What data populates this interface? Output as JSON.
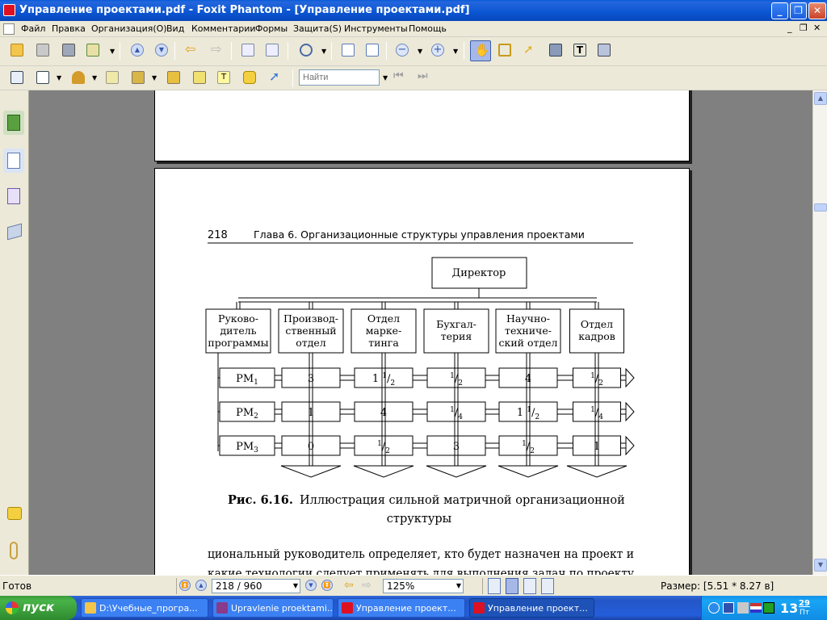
{
  "window": {
    "title": "Управление проектами.pdf - Foxit Phantom - [Управление проектами.pdf]"
  },
  "menu": [
    "Файл",
    "Правка",
    "Организация(O)",
    "Вид",
    "Комментарии",
    "Формы",
    "Защита(S)",
    "Инструменты",
    "Помощь"
  ],
  "toolbar": {
    "find_placeholder": "Найти"
  },
  "page": {
    "header_number": "218",
    "header_title": "Глава 6. Организационные структуры управления проектами",
    "director": "Директор",
    "departments": [
      [
        "Руково-",
        "дитель",
        "программы"
      ],
      [
        "Производ-",
        "ственный",
        "отдел"
      ],
      [
        "Отдел",
        "марке-",
        "тинга"
      ],
      [
        "Бухгал-",
        "терия"
      ],
      [
        "Научно-",
        "техничe-",
        "ский отдел"
      ],
      [
        "Отдел",
        "кадров"
      ]
    ],
    "rows": [
      {
        "label": "РМ",
        "sub": "1",
        "cells": [
          {
            "w": "3"
          },
          {
            "w": "1",
            "n": "1",
            "d": "2"
          },
          {
            "n": "1",
            "d": "2"
          },
          {
            "w": "4"
          },
          {
            "n": "1",
            "d": "2"
          }
        ]
      },
      {
        "label": "РМ",
        "sub": "2",
        "cells": [
          {
            "w": "1"
          },
          {
            "w": "4"
          },
          {
            "n": "1",
            "d": "4"
          },
          {
            "w": "1",
            "n": "1",
            "d": "2"
          },
          {
            "n": "1",
            "d": "4"
          }
        ]
      },
      {
        "label": "РМ",
        "sub": "3",
        "cells": [
          {
            "w": "0"
          },
          {
            "n": "1",
            "d": "2"
          },
          {
            "w": "3"
          },
          {
            "n": "1",
            "d": "2"
          },
          {
            "w": "1"
          }
        ]
      }
    ],
    "caption_label": "Рис. 6.16.",
    "caption_text": "Иллюстрация сильной матричной организационной",
    "caption_text2": "структуры",
    "body_line1": "циональный руководитель определяет, кто будет назначен на проект и",
    "body_line2": "какие технологии следует применять для выполнения задач по проекту"
  },
  "status": {
    "ready": "Готов",
    "page_field": "218 / 960",
    "zoom": "125%",
    "size": "Размер: [5.51 * 8.27 в]"
  },
  "taskbar": {
    "start": "пуск",
    "tasks": [
      "D:\\Учебные_програ...",
      "Upravlenie proektami...",
      "Управление проект...",
      "Управление проект..."
    ],
    "clock_h": "13",
    "clock_m": "29",
    "clock_day": "Пт"
  }
}
